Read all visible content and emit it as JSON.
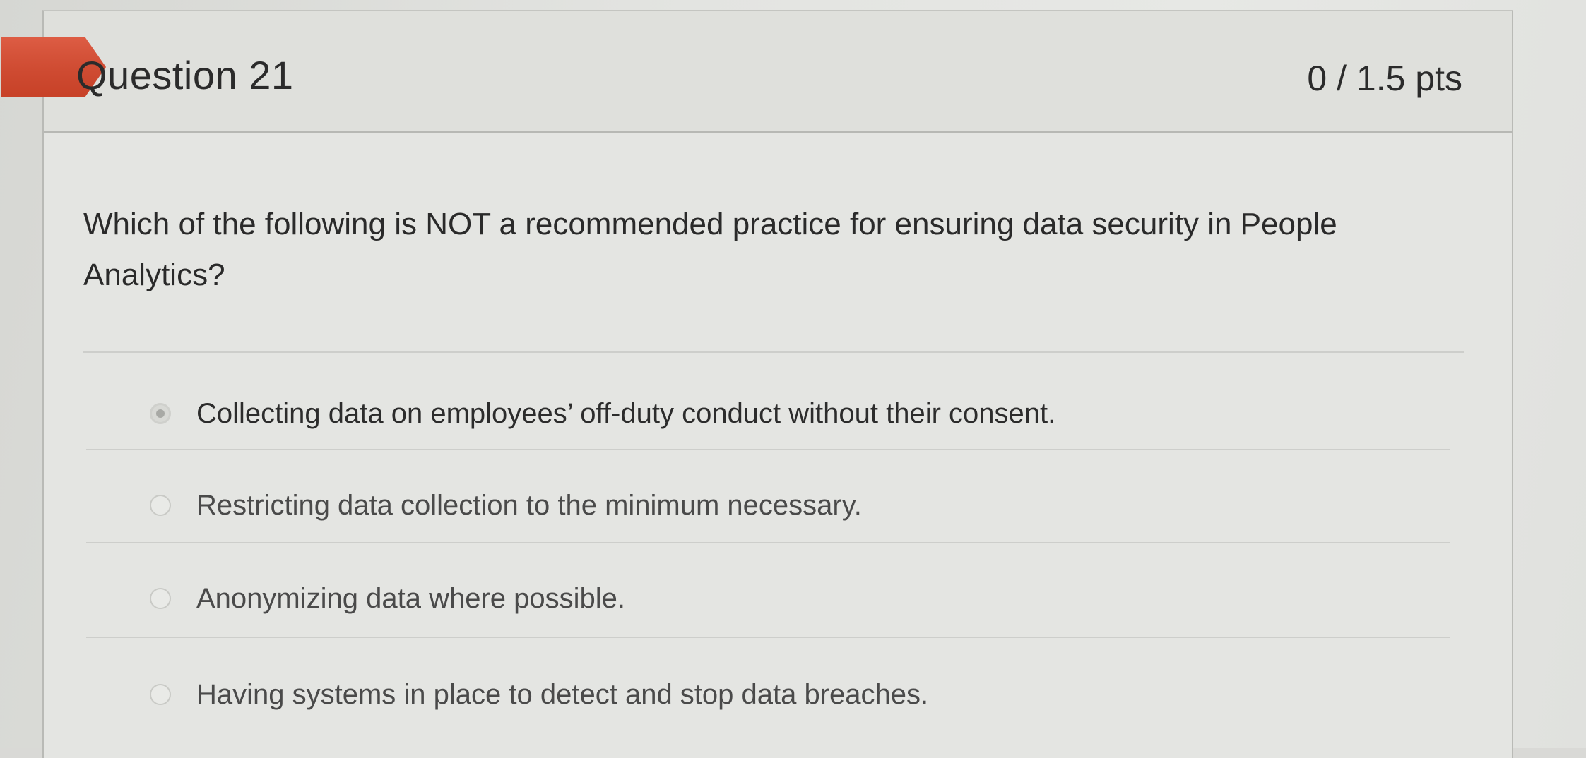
{
  "question": {
    "title": "Question 21",
    "points": "0 / 1.5 pts",
    "text": "Which of the following is NOT a recommended practice for ensuring data security in People Analytics?",
    "flag_color": "#d9472b"
  },
  "answers": [
    {
      "label": "Collecting data on employees’ off-duty conduct without their consent.",
      "selected": true
    },
    {
      "label": "Restricting data collection to the minimum necessary.",
      "selected": false
    },
    {
      "label": "Anonymizing data where possible.",
      "selected": false
    },
    {
      "label": "Having systems in place to detect and stop data breaches.",
      "selected": false
    }
  ]
}
